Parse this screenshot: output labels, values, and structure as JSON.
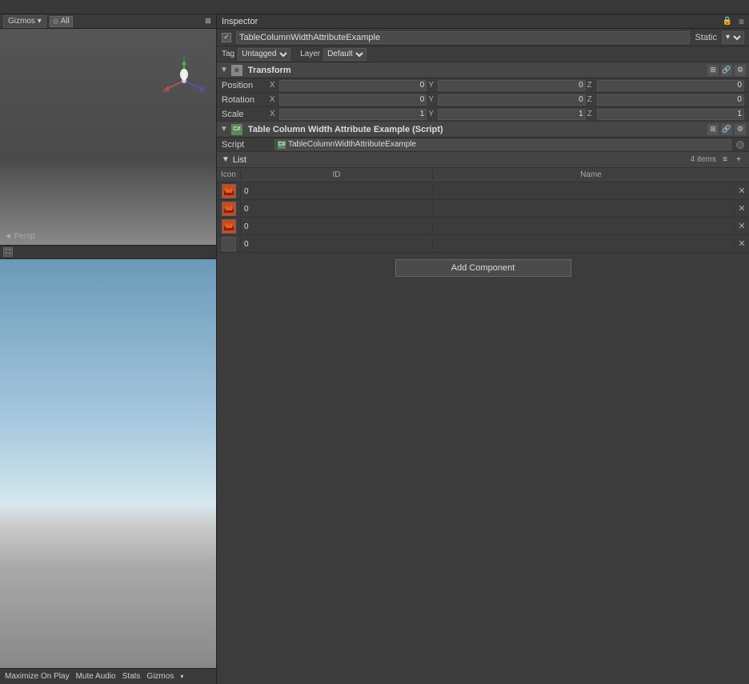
{
  "topbar": {
    "gizmos_label": "Gizmos",
    "all_label": "All",
    "search_placeholder": "All"
  },
  "scene_toolbar": {
    "gizmos_label": "Gizmos",
    "arrow": "▾"
  },
  "scene_view": {
    "persp_label": "◄ Persp"
  },
  "bottom_toolbar": {
    "maximize_label": "Maximize On Play",
    "mute_label": "Mute Audio",
    "stats_label": "Stats",
    "gizmos_label": "Gizmos",
    "arrow": "▾"
  },
  "inspector": {
    "title": "Inspector",
    "gameobject_name": "TableColumnWidthAttributeExample",
    "static_label": "Static",
    "static_arrow": "▾",
    "tag_label": "Tag",
    "tag_value": "Untagged",
    "layer_label": "Layer",
    "layer_value": "Default"
  },
  "transform": {
    "component_name": "Transform",
    "position_label": "Position",
    "rotation_label": "Rotation",
    "scale_label": "Scale",
    "position": {
      "x": "0",
      "y": "0",
      "z": "0"
    },
    "rotation": {
      "x": "0",
      "y": "0",
      "z": "0"
    },
    "scale": {
      "x": "1",
      "y": "1",
      "z": "1"
    }
  },
  "script_component": {
    "component_name": "Table Column Width Attribute Example (Script)",
    "script_label": "Script",
    "script_value": "TableColumnWidthAttributeExample"
  },
  "list": {
    "title": "List",
    "count": "4 items",
    "col_icon": "Icon",
    "col_id": "ID",
    "col_name": "Name",
    "rows": [
      {
        "has_icon": true,
        "id": "0",
        "name": ""
      },
      {
        "has_icon": true,
        "id": "0",
        "name": ""
      },
      {
        "has_icon": true,
        "id": "0",
        "name": ""
      },
      {
        "has_icon": false,
        "id": "0",
        "name": ""
      }
    ]
  },
  "add_component": {
    "label": "Add Component"
  },
  "icons": {
    "triangle_right": "▶",
    "triangle_down": "▼",
    "lock": "🔒",
    "kebab": "≡",
    "plus": "+",
    "x": "✕",
    "checkmark": "✓",
    "grid": "⊞",
    "eye": "👁",
    "settings": "⚙"
  }
}
